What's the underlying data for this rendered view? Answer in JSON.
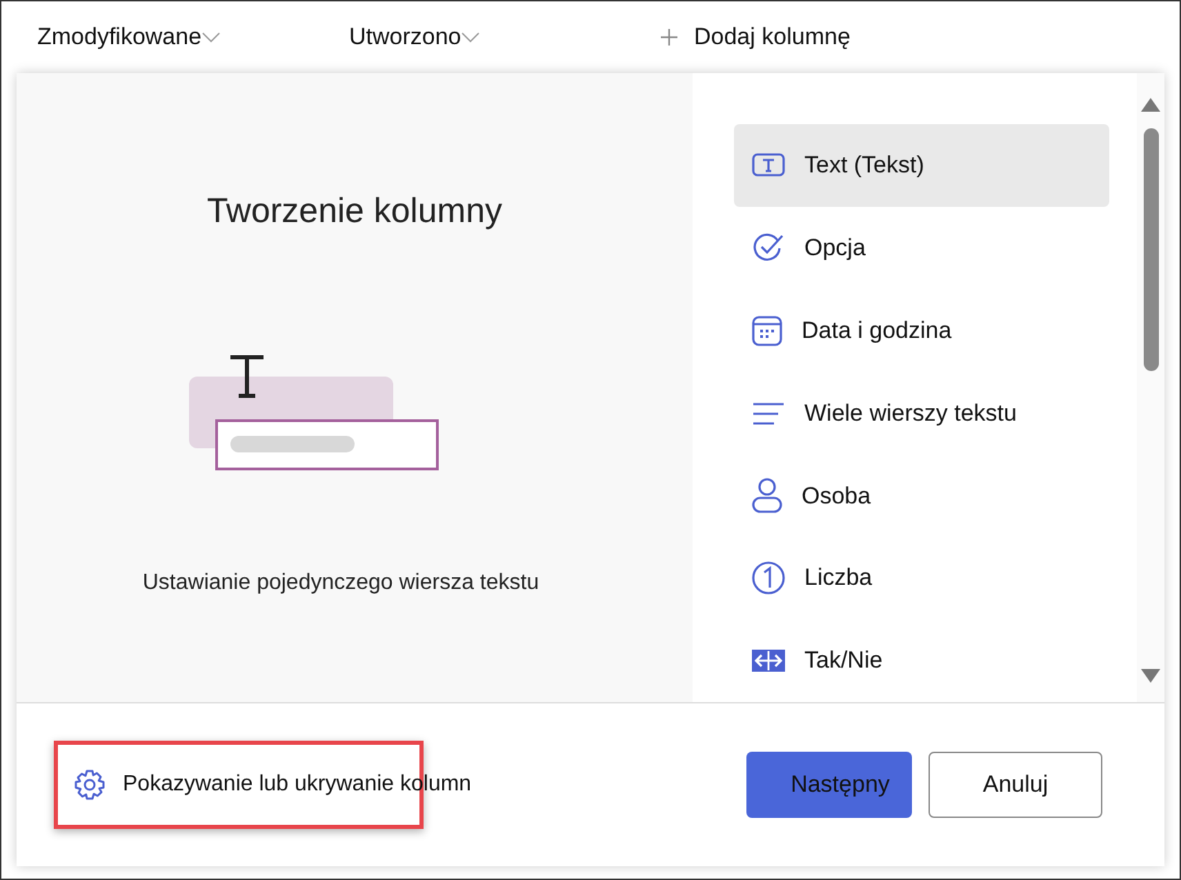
{
  "header": {
    "columns": [
      {
        "label": "Zmodyfikowane",
        "kind": "sortable"
      },
      {
        "label": "Utworzono",
        "kind": "dropdown"
      },
      {
        "label": "Dodaj kolumnę",
        "kind": "add"
      }
    ]
  },
  "dialog": {
    "title": "Tworzenie kolumny",
    "description": "Ustawianie pojedynczego wiersza tekstu",
    "types": [
      {
        "label": "Text (Tekst)",
        "kind": "text",
        "selected": true
      },
      {
        "label": "Opcja",
        "kind": "choice",
        "selected": false
      },
      {
        "label": "Data i godzina",
        "kind": "date",
        "selected": false
      },
      {
        "label": "Wiele wierszy tekstu",
        "kind": "multiline",
        "selected": false
      },
      {
        "label": "Osoba",
        "kind": "person",
        "selected": false
      },
      {
        "label": "Liczba",
        "kind": "number",
        "selected": false
      },
      {
        "label": "Tak/Nie",
        "kind": "yesno",
        "selected": false
      }
    ],
    "footer_link": {
      "label": "Pokazywanie lub ukrywanie kolumn",
      "highlighted": true
    },
    "buttons": [
      {
        "label": "Następny",
        "kind": "primary"
      },
      {
        "label": "Anuluj",
        "kind": "secondary"
      }
    ]
  }
}
